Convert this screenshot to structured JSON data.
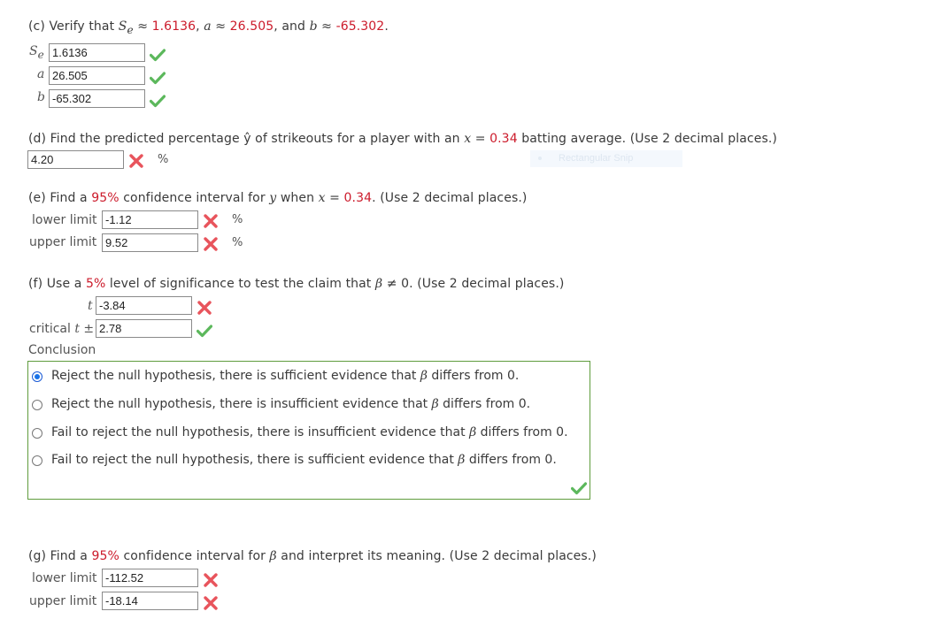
{
  "part_c": {
    "prefix": "(c) Verify that ",
    "se_symbol": "S",
    "se_sub": "e",
    "approx1": " ≈ ",
    "se_value": "1.6136",
    "sep1": ", ",
    "a_symbol": "a",
    "approx2": " ≈ ",
    "a_value": "26.505",
    "sep2": ", and ",
    "b_symbol": "b",
    "approx3": " ≈ ",
    "b_value": "-65.302",
    "end": ".",
    "fields": [
      {
        "label": "S",
        "sub": "e",
        "value": "1.6136",
        "status": "correct"
      },
      {
        "label": "a",
        "value": "26.505",
        "status": "correct"
      },
      {
        "label": "b",
        "value": "-65.302",
        "status": "correct"
      }
    ]
  },
  "part_d": {
    "prefix": "(d) Find the predicted percentage ",
    "yhat": "ŷ",
    "middle": " of strikeouts for a player with an ",
    "x_symbol": "x",
    "eq": " = ",
    "x_value": "0.34",
    "suffix": " batting average. (Use 2 decimal places.)",
    "field": {
      "value": "4.20",
      "status": "incorrect",
      "unit": "%"
    }
  },
  "snip_overlay": {
    "label": "Rectangular Snip"
  },
  "part_e": {
    "prefix": "(e) Find a ",
    "conf": "95%",
    "middle": " confidence interval for ",
    "y_symbol": "y",
    "when": " when ",
    "x_symbol": "x",
    "eq": " = ",
    "x_value": "0.34",
    "suffix": ". (Use 2 decimal places.)",
    "fields": [
      {
        "label": "lower limit",
        "value": "-1.12",
        "status": "incorrect",
        "unit": "%"
      },
      {
        "label": "upper limit",
        "value": "9.52",
        "status": "incorrect",
        "unit": "%"
      }
    ]
  },
  "part_f": {
    "prefix": "(f) Use a ",
    "level": "5%",
    "middle": " level of significance to test the claim that ",
    "beta": "β",
    "suffix": " ≠ 0. (Use 2 decimal places.)",
    "t_label": "t",
    "t_value": "-3.84",
    "t_status": "incorrect",
    "crit_label_pre": "critical ",
    "crit_t": "t",
    "crit_pm": " ±",
    "crit_value": "2.78",
    "crit_status": "correct",
    "conclusion_label": "Conclusion",
    "options": [
      {
        "pre": "Reject the null hypothesis, there is sufficient evidence that ",
        "beta": "β",
        "post": " differs from 0.",
        "selected": true
      },
      {
        "pre": "Reject the null hypothesis, there is insufficient evidence that ",
        "beta": "β",
        "post": " differs from 0.",
        "selected": false
      },
      {
        "pre": "Fail to reject the null hypothesis, there is insufficient evidence that ",
        "beta": "β",
        "post": " differs from 0.",
        "selected": false
      },
      {
        "pre": "Fail to reject the null hypothesis, there is sufficient evidence that ",
        "beta": "β",
        "post": " differs from 0.",
        "selected": false
      }
    ],
    "conclusion_status": "correct"
  },
  "part_g": {
    "prefix": "(g) Find a ",
    "conf": "95%",
    "middle": " confidence interval for ",
    "beta": "β",
    "suffix": " and interpret its meaning. (Use 2 decimal places.)",
    "fields": [
      {
        "label": "lower limit",
        "value": "-112.52",
        "status": "incorrect"
      },
      {
        "label": "upper limit",
        "value": "-18.14",
        "status": "incorrect"
      }
    ]
  },
  "colors": {
    "highlight_red": "#cc1b2b",
    "check_green": "#5cb85c",
    "cross_red": "#e8545c",
    "box_border": "#5f9c3d",
    "radio_selected": "#1a73e8"
  }
}
